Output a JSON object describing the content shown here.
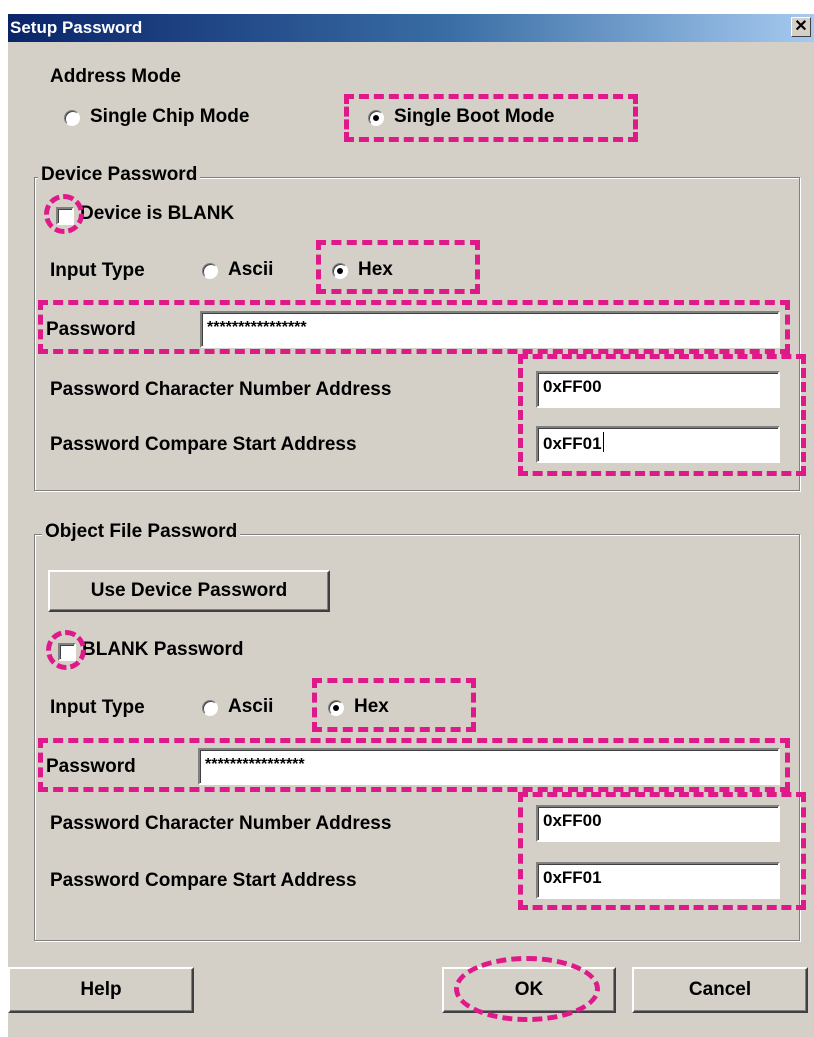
{
  "window": {
    "title": "Setup Password",
    "close_glyph": "✕"
  },
  "address_mode": {
    "label": "Address Mode",
    "options": [
      "Single Chip Mode",
      "Single Boot Mode"
    ],
    "selected": "Single Boot Mode"
  },
  "device": {
    "legend": "Device Password",
    "blank_label": "Device is BLANK",
    "blank_checked": false,
    "input_type_label": "Input Type",
    "input_types": [
      "Ascii",
      "Hex"
    ],
    "input_type_selected": "Hex",
    "password_label": "Password",
    "password_value": "****************",
    "char_num_label": "Password Character Number Address",
    "char_num_value": "0xFF00",
    "compare_label": "Password Compare Start Address",
    "compare_value": "0xFF01"
  },
  "object": {
    "legend": "Object File Password",
    "use_device_button": "Use Device Password",
    "blank_label": "BLANK Password",
    "blank_checked": false,
    "input_type_label": "Input Type",
    "input_types": [
      "Ascii",
      "Hex"
    ],
    "input_type_selected": "Hex",
    "password_label": "Password",
    "password_value": "****************",
    "char_num_label": "Password Character Number Address",
    "char_num_value": "0xFF00",
    "compare_label": "Password Compare Start Address",
    "compare_value": "0xFF01"
  },
  "buttons": {
    "help": "Help",
    "ok": "OK",
    "cancel": "Cancel"
  },
  "colors": {
    "highlight": "#e0198a",
    "titlebar": "#0a246a",
    "dialog_bg": "#d4d0c8"
  }
}
